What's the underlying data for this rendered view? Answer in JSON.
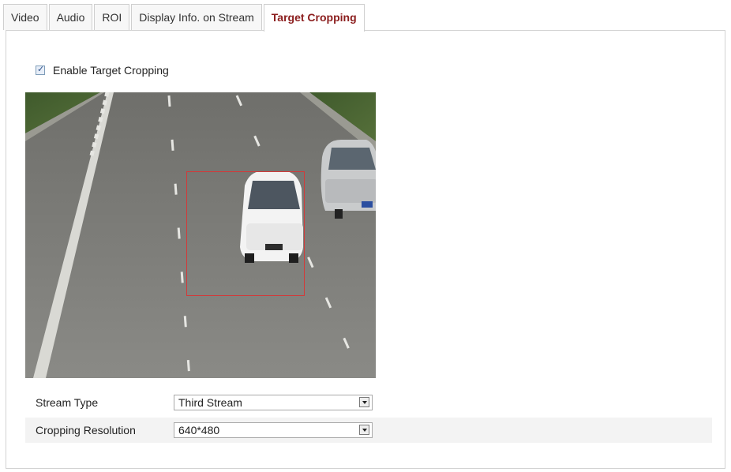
{
  "tabs": [
    {
      "label": "Video",
      "active": false
    },
    {
      "label": "Audio",
      "active": false
    },
    {
      "label": "ROI",
      "active": false
    },
    {
      "label": "Display Info. on Stream",
      "active": false
    },
    {
      "label": "Target Cropping",
      "active": true
    }
  ],
  "enable_target_cropping": {
    "label": "Enable Target Cropping",
    "checked": true
  },
  "colors": {
    "active_tab": "#8b1d1d",
    "crop_rectangle": "#d23a3a"
  },
  "stream_type": {
    "label": "Stream Type",
    "value": "Third Stream"
  },
  "cropping_resolution": {
    "label": "Cropping Resolution",
    "value": "640*480"
  }
}
